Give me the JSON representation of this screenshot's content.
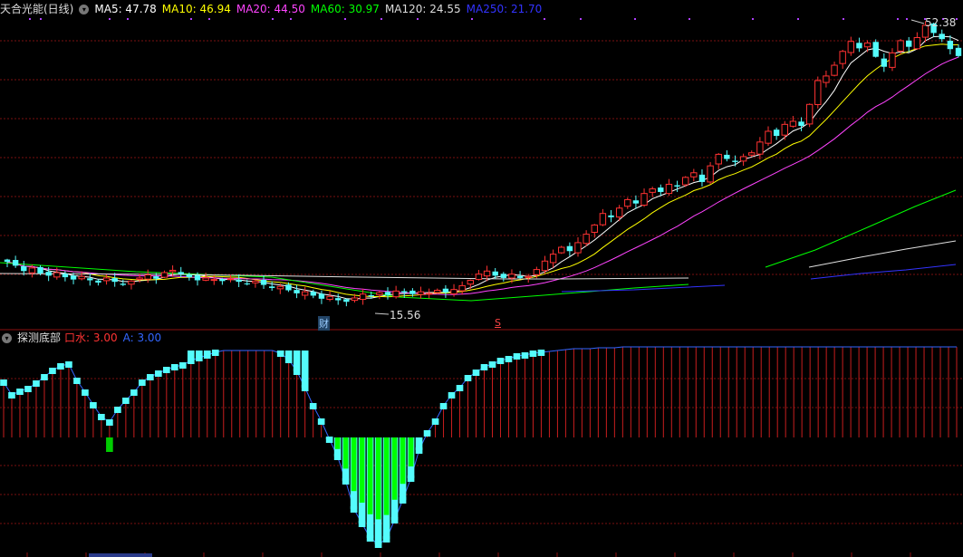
{
  "main_chart": {
    "title": "天合光能(日线)",
    "ma_legend": [
      {
        "label": "MA5: 47.78",
        "color": "#ffffff"
      },
      {
        "label": "MA10: 46.94",
        "color": "#ffff00"
      },
      {
        "label": "MA20: 44.50",
        "color": "#ff44ff"
      },
      {
        "label": "MA60: 30.97",
        "color": "#00ff00"
      },
      {
        "label": "MA120: 24.55",
        "color": "#dddddd"
      },
      {
        "label": "MA250: 21.70",
        "color": "#3333ff"
      }
    ],
    "high_label": "52.38",
    "low_label": "15.56",
    "marker_cai": "财",
    "marker_s": "S"
  },
  "indicator": {
    "title": "探测底部",
    "legend": [
      {
        "label": "口水: 3.00",
        "color": "#ff3333"
      },
      {
        "label": "A: 3.00",
        "color": "#3366ff"
      }
    ]
  },
  "chart_data": [
    {
      "type": "candlestick",
      "title": "天合光能(日线)",
      "series": [
        {
          "name": "MA5",
          "last": 47.78
        },
        {
          "name": "MA10",
          "last": 46.94
        },
        {
          "name": "MA20",
          "last": 44.5
        },
        {
          "name": "MA60",
          "last": 30.97
        },
        {
          "name": "MA120",
          "last": 24.55
        },
        {
          "name": "MA250",
          "last": 21.7
        }
      ],
      "annotations": [
        "52.38",
        "15.56"
      ],
      "closes": [
        21.0,
        20.5,
        19.8,
        20.2,
        19.5,
        19.2,
        19.6,
        19.0,
        18.7,
        19.1,
        18.6,
        18.3,
        18.9,
        18.4,
        18.0,
        18.5,
        18.9,
        19.3,
        18.8,
        19.6,
        19.9,
        19.4,
        19.0,
        18.6,
        18.9,
        18.7,
        18.5,
        18.8,
        18.4,
        18.1,
        18.5,
        18.0,
        17.6,
        17.8,
        17.3,
        16.9,
        17.1,
        16.6,
        16.2,
        16.5,
        16.0,
        15.8,
        16.3,
        16.8,
        16.5,
        17.0,
        16.7,
        17.2,
        17.0,
        16.8,
        17.1,
        16.9,
        17.3,
        17.0,
        17.4,
        17.9,
        18.6,
        19.4,
        19.8,
        19.2,
        18.9,
        19.4,
        18.9,
        19.1,
        20.0,
        21.1,
        22.0,
        22.9,
        22.4,
        23.5,
        24.6,
        25.8,
        27.3,
        26.8,
        28.0,
        29.1,
        28.6,
        29.9,
        30.5,
        30.1,
        31.1,
        30.8,
        32.0,
        32.6,
        31.4,
        33.5,
        35.0,
        34.4,
        34.0,
        34.7,
        35.2,
        36.6,
        38.0,
        37.4,
        38.9,
        39.3,
        38.7,
        41.5,
        44.6,
        45.2,
        46.6,
        48.4,
        49.7,
        48.8,
        49.5,
        47.7,
        46.4,
        48.2,
        49.8,
        49.0,
        50.2,
        51.8,
        50.8,
        50.0,
        48.7,
        47.8
      ]
    },
    {
      "type": "bar",
      "title": "探测底部",
      "series": [
        {
          "name": "口水",
          "last": 3.0
        },
        {
          "name": "A",
          "last": 3.0
        }
      ],
      "values": [
        61,
        47,
        51,
        54,
        60,
        67,
        74,
        79,
        81,
        63,
        50,
        36,
        23,
        17,
        31,
        41,
        50,
        61,
        67,
        71,
        75,
        78,
        80,
        85,
        88,
        91,
        94,
        96,
        96,
        96,
        96,
        96,
        96,
        96,
        93,
        86,
        73,
        55,
        35,
        18,
        -2,
        -21,
        -48,
        -79,
        -95,
        -111,
        -118,
        -112,
        -91,
        -69,
        -45,
        -14,
        5,
        18,
        35,
        47,
        55,
        66,
        72,
        78,
        81,
        85,
        87,
        90,
        91,
        93,
        94,
        95,
        96,
        97,
        98,
        98,
        98,
        99,
        99,
        99,
        100,
        100,
        100,
        100,
        100,
        100,
        100,
        100,
        100,
        100,
        100,
        100,
        100,
        100,
        100,
        100,
        100,
        100,
        100,
        100,
        100,
        100,
        100,
        100,
        100,
        100,
        100,
        100,
        100,
        100,
        100,
        100,
        100,
        100,
        100,
        100,
        100,
        100,
        100,
        100,
        100,
        100
      ],
      "ylim": [
        -125,
        100
      ]
    }
  ]
}
